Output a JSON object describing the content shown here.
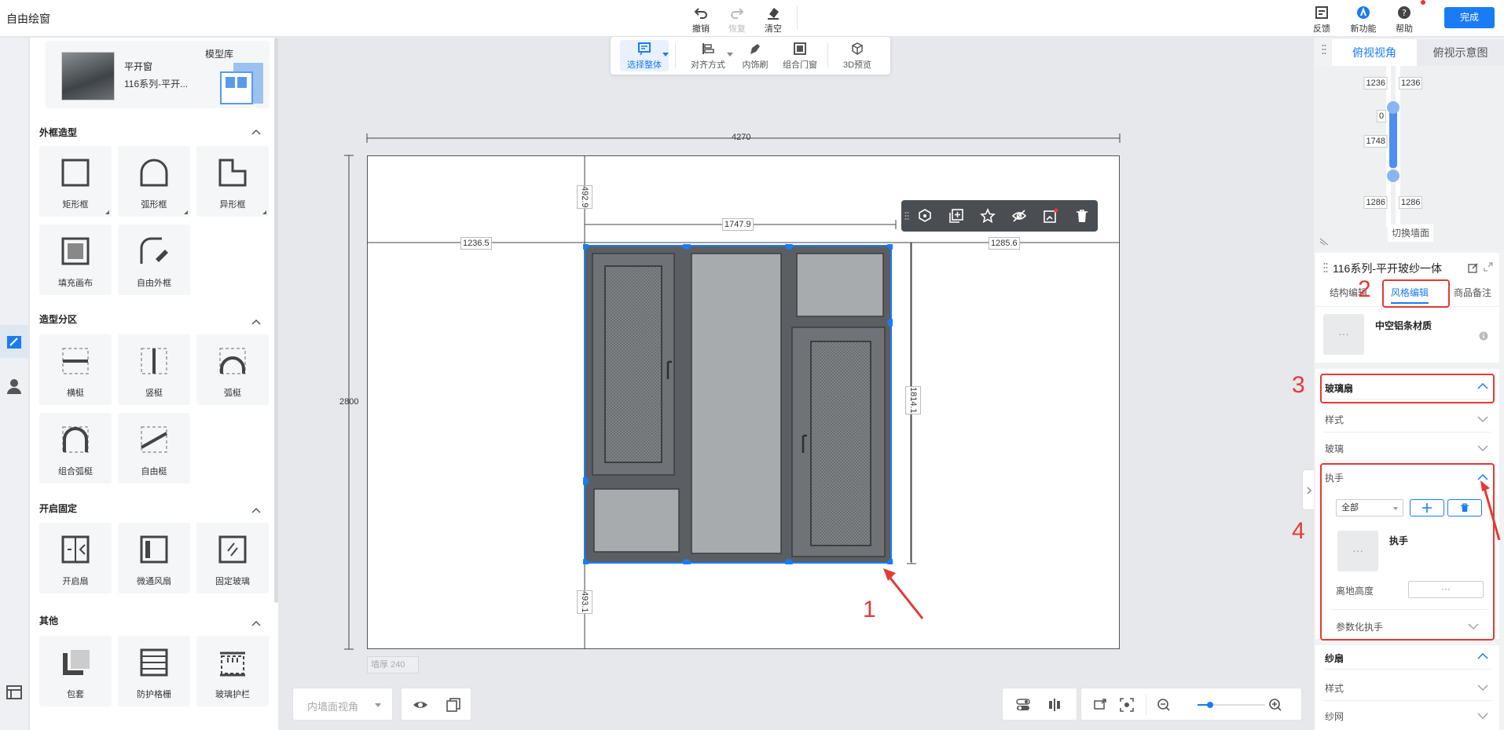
{
  "app": {
    "title": "自由绘窗"
  },
  "toolbar": {
    "undo": "撤销",
    "redo": "恢复",
    "clear": "清空",
    "feedback": "反馈",
    "new_features": "新功能",
    "help": "帮助",
    "done": "完成"
  },
  "left_panel": {
    "model_name": "平开窗",
    "model_sub": "116系列-平开...",
    "model_library": "模型库",
    "sections": [
      {
        "title": "外框造型",
        "items": [
          "矩形框",
          "弧形框",
          "异形框",
          "填充画布",
          "自由外框"
        ]
      },
      {
        "title": "造型分区",
        "items": [
          "横梃",
          "竖梃",
          "弧梃",
          "组合弧梃",
          "自由梃"
        ]
      },
      {
        "title": "开启固定",
        "items": [
          "开启扇",
          "微通风扇",
          "固定玻璃"
        ]
      },
      {
        "title": "其他",
        "items": [
          "包套",
          "防护格栅",
          "玻璃护栏"
        ]
      }
    ]
  },
  "float_toolbar": {
    "select_all": "选择整体",
    "align": "对齐方式",
    "decor": "内饰刷",
    "combo": "组合门窗",
    "preview3d": "3D预览"
  },
  "canvas": {
    "dims": {
      "total_width": "4270",
      "total_height": "2800",
      "top_gap": "492.9",
      "window_width": "1747.9",
      "left_gap": "1236.5",
      "right_gap": "1285.6",
      "window_height": "1814.1",
      "bottom_gap": "493.1"
    },
    "wall_thickness": "墙厚 240"
  },
  "bottom": {
    "view_mode": "内墙面视角"
  },
  "right_panel": {
    "tabs": [
      "俯视视角",
      "俯视示意图"
    ],
    "mini": {
      "top_left": "1236",
      "top_right": "1236",
      "zero": "0",
      "mid": "1748",
      "bot_left": "1286",
      "bot_right": "1286",
      "switch_wall": "切换墙面"
    },
    "title": "116系列-平开玻纱一体",
    "prop_tabs": [
      "结构编辑",
      "风格编辑",
      "商品备注"
    ],
    "material_name": "中空铝条材质",
    "glass_sash": {
      "title": "玻璃扇",
      "rows": [
        "样式",
        "玻璃"
      ]
    },
    "handle": {
      "title": "执手",
      "filter": "全部",
      "item": "执手",
      "height_label": "离地高度",
      "param": "参数化执手"
    },
    "screen_sash": {
      "title": "纱扇",
      "rows": [
        "样式",
        "纱网"
      ]
    },
    "placeholder": "···"
  },
  "annotations": [
    "1",
    "2",
    "3",
    "4"
  ]
}
